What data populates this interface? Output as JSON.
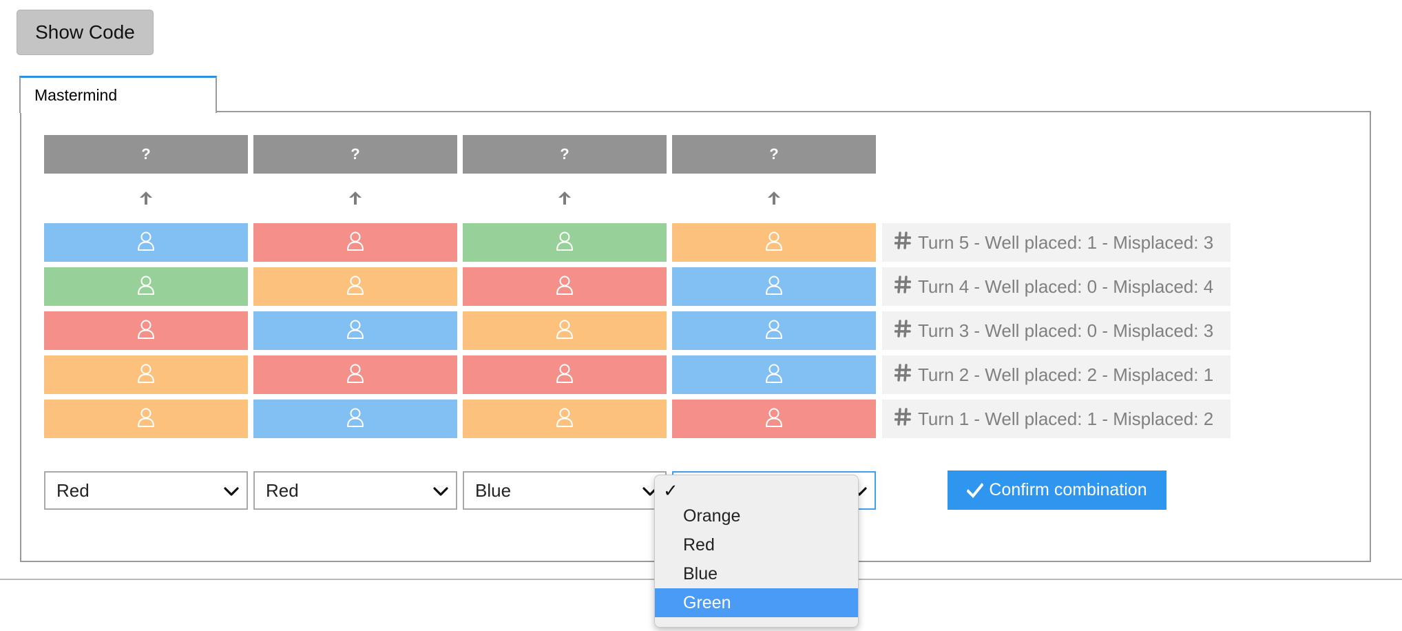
{
  "toolbar": {
    "show_code_label": "Show Code"
  },
  "tab": {
    "label": "Mastermind"
  },
  "colors": {
    "Blue": "#82c0f3",
    "Red": "#f58f8a",
    "Green": "#98d09a",
    "Orange": "#fcc27d",
    "secret": "#939393",
    "confirm": "#2e96ef",
    "dropdown_highlight": "#4a9bf5"
  },
  "secret": [
    "?",
    "?",
    "?",
    "?"
  ],
  "turns": [
    {
      "pegs": [
        "Blue",
        "Red",
        "Green",
        "Orange"
      ],
      "label": "Turn 5 - Well placed: 1 - Misplaced: 3"
    },
    {
      "pegs": [
        "Green",
        "Orange",
        "Red",
        "Blue"
      ],
      "label": "Turn 4 - Well placed: 0 - Misplaced: 4"
    },
    {
      "pegs": [
        "Red",
        "Blue",
        "Orange",
        "Blue"
      ],
      "label": "Turn 3 - Well placed: 0 - Misplaced: 3"
    },
    {
      "pegs": [
        "Orange",
        "Red",
        "Red",
        "Blue"
      ],
      "label": "Turn 2 - Well placed: 2 - Misplaced: 1"
    },
    {
      "pegs": [
        "Orange",
        "Blue",
        "Orange",
        "Red"
      ],
      "label": "Turn 1 - Well placed: 1 - Misplaced: 2"
    }
  ],
  "selects": [
    {
      "value": "Red"
    },
    {
      "value": "Red"
    },
    {
      "value": "Blue"
    },
    {
      "value": ""
    }
  ],
  "confirm_label": "Confirm combination",
  "dropdown": {
    "check_mark": "✓",
    "options": [
      "Orange",
      "Red",
      "Blue",
      "Green"
    ],
    "highlighted": "Green"
  },
  "icons": {
    "secret_arrow": "arrow-up-icon",
    "peg": "user-icon",
    "feedback": "hash-icon",
    "confirm": "check-icon",
    "select": "chevron-down-icon"
  }
}
